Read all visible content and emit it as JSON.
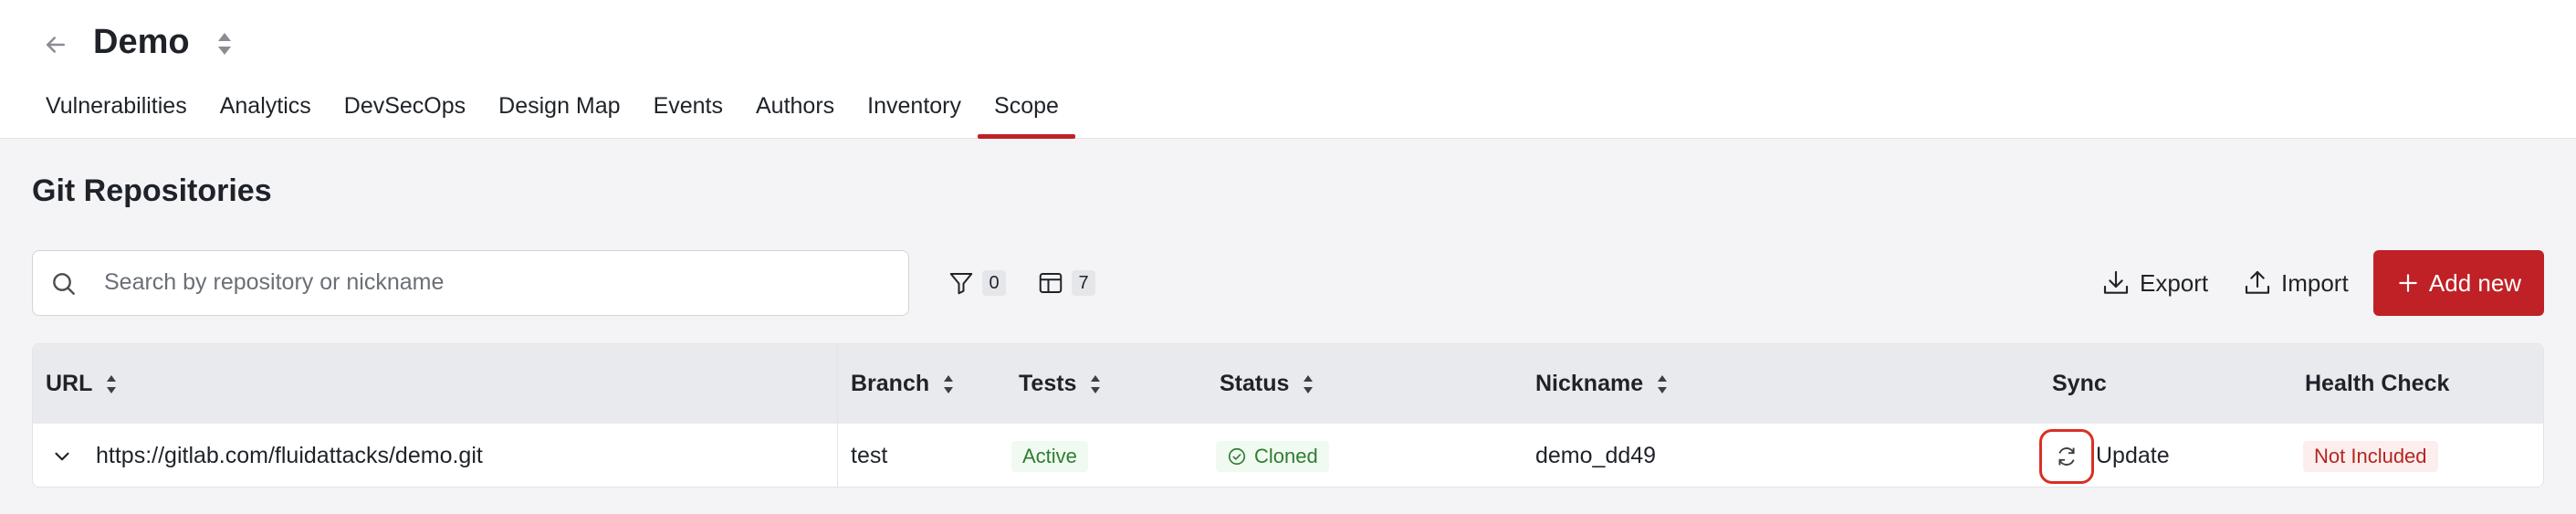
{
  "header": {
    "title": "Demo",
    "tabs": [
      {
        "label": "Vulnerabilities"
      },
      {
        "label": "Analytics"
      },
      {
        "label": "DevSecOps"
      },
      {
        "label": "Design Map"
      },
      {
        "label": "Events"
      },
      {
        "label": "Authors"
      },
      {
        "label": "Inventory"
      },
      {
        "label": "Scope",
        "active": true
      }
    ]
  },
  "section": {
    "title": "Git Repositories"
  },
  "toolbar": {
    "search_placeholder": "Search by repository or nickname",
    "search_value": "",
    "filters_count": "0",
    "columns_count": "7",
    "export_label": "Export",
    "import_label": "Import",
    "add_new_label": "Add new"
  },
  "table": {
    "columns": [
      "URL",
      "Branch",
      "Tests",
      "Status",
      "Nickname",
      "Sync",
      "Health Check"
    ],
    "rows": [
      {
        "url": "https://gitlab.com/fluidattacks/demo.git",
        "branch": "test",
        "tests": "Active",
        "status": "Cloned",
        "nickname": "demo_dd49",
        "sync": "Update",
        "health_check": "Not Included"
      }
    ]
  },
  "colors": {
    "accent": "#bf2126",
    "active_tab_underline": "#bf2126",
    "status_green": "#2e7d32",
    "not_included_red": "#b3261e"
  },
  "icons": [
    "arrow-left-icon",
    "sort-icon",
    "search-icon",
    "filter-icon",
    "columns-icon",
    "download-icon",
    "upload-icon",
    "plus-icon",
    "chevron-down-icon",
    "check-circle-icon",
    "refresh-icon"
  ]
}
